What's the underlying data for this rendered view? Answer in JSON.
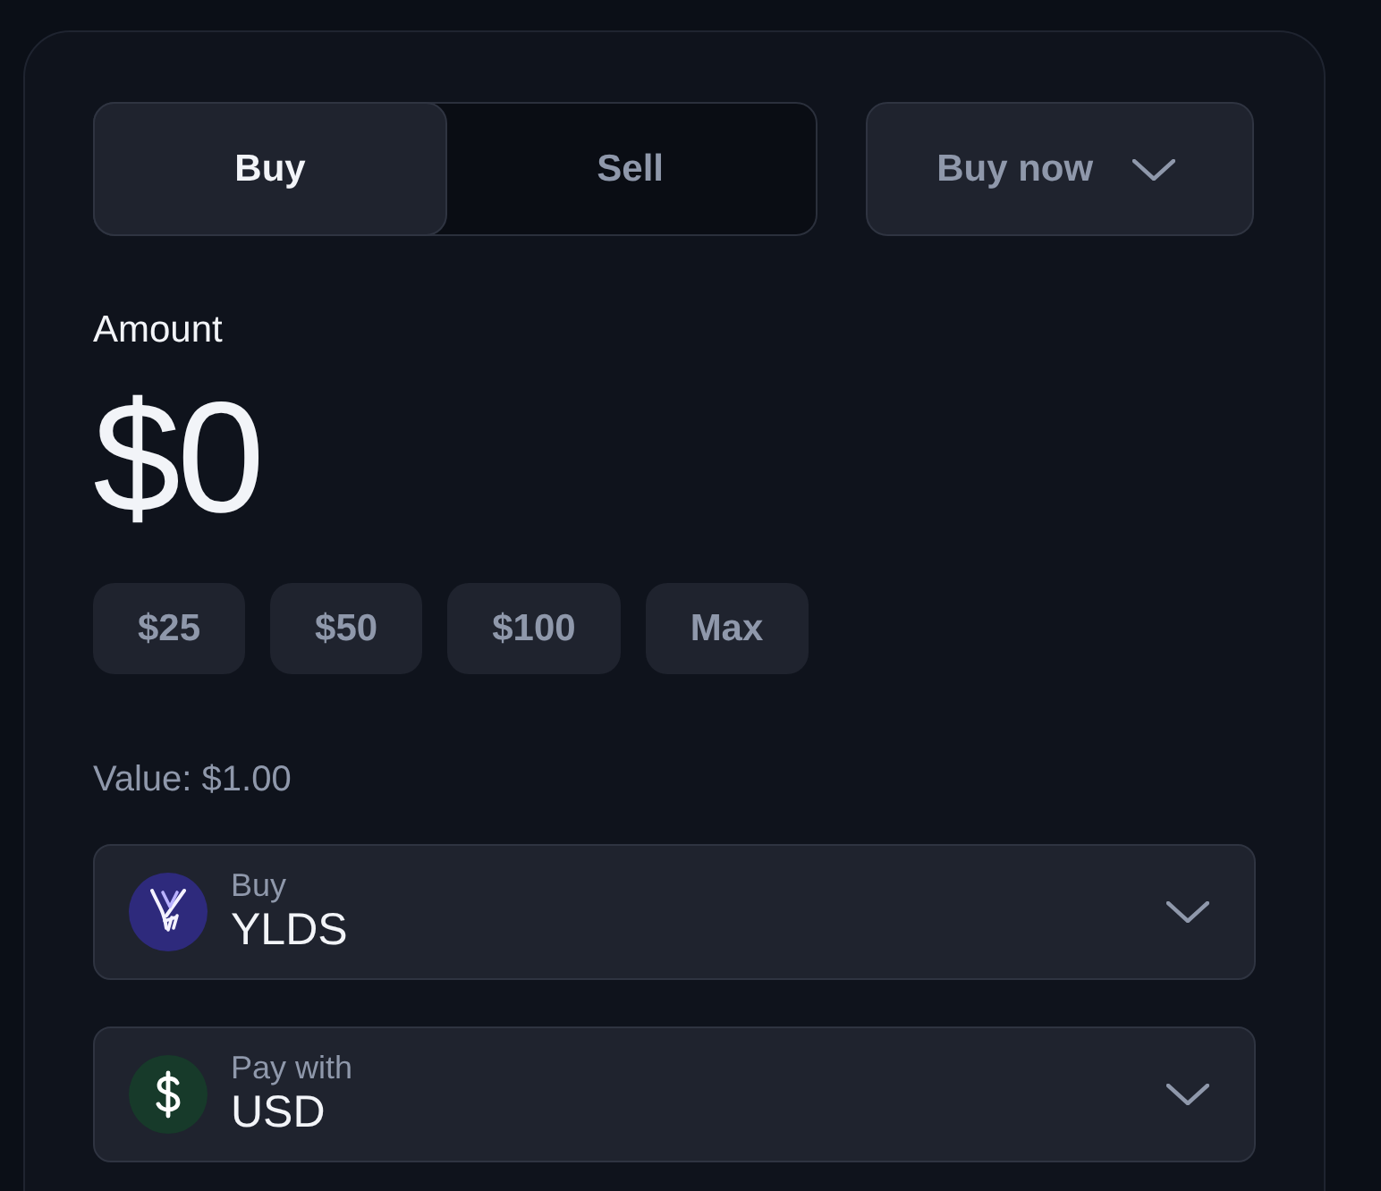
{
  "mode_toggle": [
    {
      "label": "Buy",
      "selected": true
    },
    {
      "label": "Sell",
      "selected": false
    }
  ],
  "order_type": {
    "label": "Buy now"
  },
  "amount": {
    "label": "Amount",
    "value": "$0",
    "presets": [
      "$25",
      "$50",
      "$100",
      "Max"
    ]
  },
  "value_text": "Value: $1.00",
  "selects": [
    {
      "kind": "token",
      "label": "Buy",
      "value": "YLDS"
    },
    {
      "kind": "dollar",
      "label": "Pay with",
      "value": "USD"
    }
  ]
}
